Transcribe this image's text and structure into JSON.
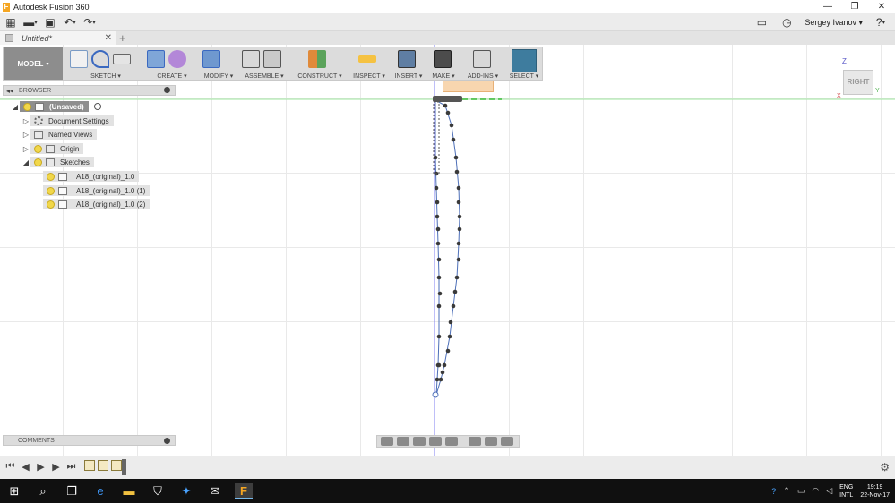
{
  "window": {
    "title": "Autodesk Fusion 360"
  },
  "user": {
    "name": "Sergey Ivanov"
  },
  "document": {
    "tab_label": "Untitled*"
  },
  "toolbar": {
    "mode_label": "MODEL",
    "groups": [
      "SKETCH",
      "CREATE",
      "MODIFY",
      "ASSEMBLE",
      "CONSTRUCT",
      "INSPECT",
      "INSERT",
      "MAKE",
      "ADD-INS",
      "SELECT"
    ]
  },
  "viewcube": {
    "face_label": "RIGHT",
    "axis_z": "Z",
    "axis_y": "Y",
    "axis_x": "X"
  },
  "browser": {
    "title": "BROWSER",
    "root": "(Unsaved)",
    "items": [
      "Document Settings",
      "Named Views",
      "Origin",
      "Sketches"
    ],
    "sketches": [
      "A18_(original)_1.0",
      "A18_(original)_1.0 (1)",
      "A18_(original)_1.0 (2)"
    ]
  },
  "comments": {
    "title": "COMMENTS"
  },
  "taskbar": {
    "lang_top": "ENG",
    "lang_bottom": "INTL",
    "time": "19:19",
    "date": "22-Nov-17"
  },
  "colors": {
    "accent_select": "#3e7c9e",
    "mode_button": "#8d8d8d",
    "taskbar": "#101010",
    "sketch_curve": "#4d6fb8",
    "sketch_points": "#3a3a3a"
  }
}
